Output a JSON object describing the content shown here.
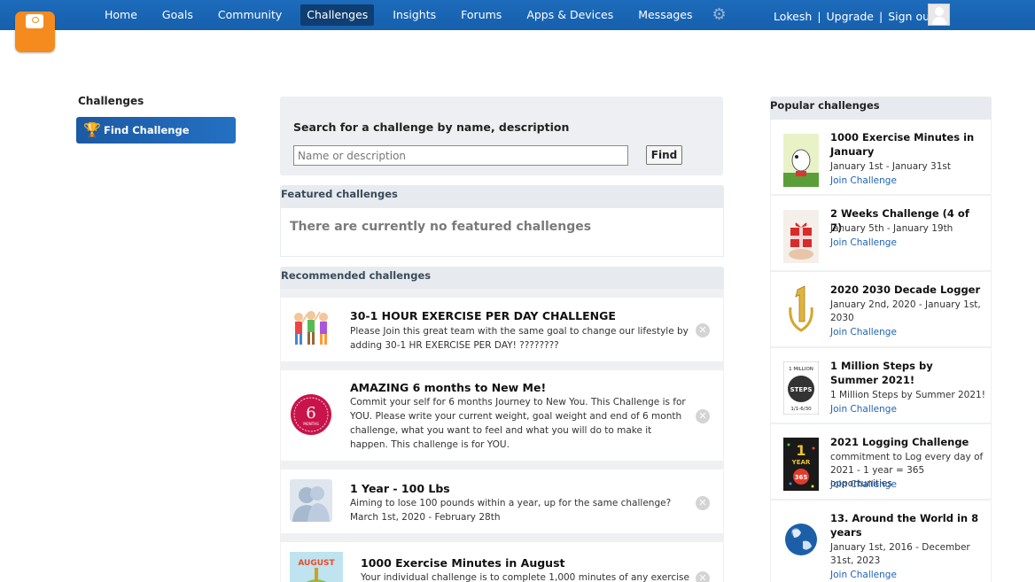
{
  "nav": {
    "items": [
      "Home",
      "Goals",
      "Community",
      "Challenges",
      "Insights",
      "Forums",
      "Apps & Devices",
      "Messages"
    ],
    "active": "Challenges",
    "settings_icon": "gear-icon"
  },
  "user": {
    "name": "Lokesh",
    "upgrade": "Upgrade",
    "signout": "Sign out",
    "sep": "|"
  },
  "sidebar": {
    "title": "Challenges",
    "find_label": "Find Challenge"
  },
  "search": {
    "title": "Search for a challenge by name, description",
    "placeholder": "Name or description",
    "value": "",
    "button": "Find"
  },
  "featured": {
    "heading": "Featured challenges",
    "empty": "There are currently no featured challenges"
  },
  "recommended": {
    "heading": "Recommended challenges",
    "items": [
      {
        "title": "30-1 HOUR EXERCISE PER DAY CHALLENGE",
        "desc": "Please Join this great team with the same goal to change our lifestyle by adding 30-1 HR EXERCISE PER DAY! ????????"
      },
      {
        "title": "AMAZING 6 months to New Me!",
        "desc": "Commit your self for 6 months Journey to New You. This Challenge is for YOU. Please write your current weight, goal weight and end of 6 month challenge, what you want to feel and what you will do to make it happen. This challenge is for YOU.",
        "badge_num": "6",
        "badge_text": "MONTHS"
      },
      {
        "title": "1 Year - 100 Lbs",
        "desc": "Aiming to lose 100 pounds within a year, up for the same challenge?March 1st, 2020 - February 28th"
      },
      {
        "title": "1000 Exercise Minutes in August",
        "desc": "Your individual challenge is to complete 1,000 minutes of any exercise",
        "thumb_text": "AUGUST"
      }
    ]
  },
  "popular": {
    "heading": "Popular challenges",
    "join_label": "Join Challenge",
    "items": [
      {
        "title": "1000 Exercise Minutes in January",
        "dates": "January 1st - January 31st"
      },
      {
        "title": "2 Weeks Challenge (4 of 7)",
        "dates": "January 5th - January 19th"
      },
      {
        "title": "2020 2030 Decade Logger",
        "dates": "January 2nd, 2020 - January 1st, 2030"
      },
      {
        "title": "1 Million Steps by Summer 2021!",
        "dates": "1 Million Steps by Summer 2021!",
        "thumb_top": "1 MILLION",
        "thumb_mid": "STEPS",
        "thumb_bottom": "1/1-6/30"
      },
      {
        "title": "2021 Logging Challenge",
        "dates": "commitment to Log every day of 2021 - 1 year = 365 opportunities",
        "thumb_top": "1",
        "thumb_mid": "YEAR",
        "thumb_bottom": "365"
      },
      {
        "title": "13. Around the World in 8 years",
        "dates": "January 1st, 2016 - December 31st, 2023"
      }
    ]
  },
  "colors": {
    "topbar": "#1d6bbb",
    "nav_active": "#0f3e73",
    "logo": "#f58a1f",
    "link": "#1f62b4",
    "panel": "#e7ebef"
  }
}
